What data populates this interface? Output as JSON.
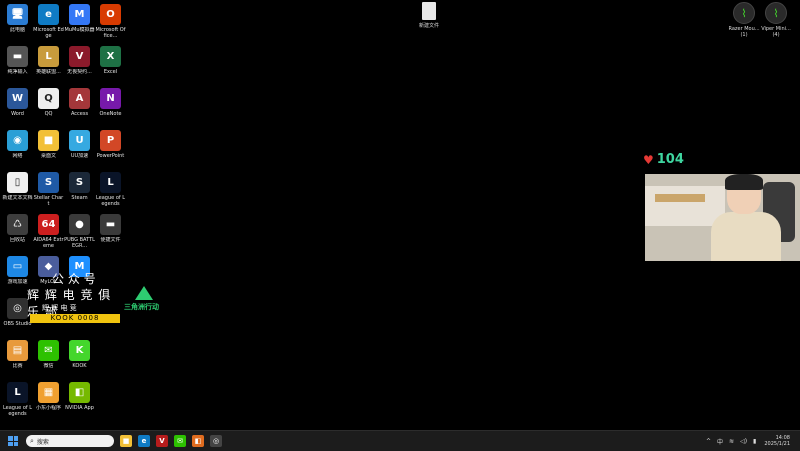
{
  "desktop_icons": [
    {
      "label": "此电脑",
      "glyph": "🖥",
      "color": "#2b7cd3"
    },
    {
      "label": "Microsoft Edge",
      "glyph": "e",
      "color": "#0f7bc4"
    },
    {
      "label": "MuMu模拟器",
      "glyph": "M",
      "color": "#3478f6"
    },
    {
      "label": "Microsoft Office...",
      "glyph": "O",
      "color": "#d83b01"
    },
    {
      "label": "纯净输入",
      "glyph": "▬",
      "color": "#555555"
    },
    {
      "label": "英雄联盟...",
      "glyph": "L",
      "color": "#c89b3c"
    },
    {
      "label": "无畏契约...",
      "glyph": "V",
      "color": "#8b1a2b"
    },
    {
      "label": "Excel",
      "glyph": "X",
      "color": "#1e7145"
    },
    {
      "label": "Word",
      "glyph": "W",
      "color": "#2b579a"
    },
    {
      "label": "QQ",
      "glyph": "Q",
      "color": "#eeeeee"
    },
    {
      "label": "Access",
      "glyph": "A",
      "color": "#a4373a"
    },
    {
      "label": "OneNote",
      "glyph": "N",
      "color": "#7719aa"
    },
    {
      "label": "网络",
      "glyph": "◉",
      "color": "#2a9fd6"
    },
    {
      "label": "桌面文",
      "glyph": "■",
      "color": "#f2c037"
    },
    {
      "label": "UU加速",
      "glyph": "U",
      "color": "#36a9e1"
    },
    {
      "label": "PowerPoint",
      "glyph": "P",
      "color": "#d24726"
    },
    {
      "label": "新建文本文档",
      "glyph": "▯",
      "color": "#f0f0f0"
    },
    {
      "label": "Stellar Chart",
      "glyph": "S",
      "color": "#1f5aa6"
    },
    {
      "label": "Steam",
      "glyph": "S",
      "color": "#1b2838"
    },
    {
      "label": "League of Legends",
      "glyph": "L",
      "color": "#0a1428"
    },
    {
      "label": "回收站",
      "glyph": "♺",
      "color": "#3d3d3d"
    },
    {
      "label": "AIDA64 Extreme",
      "glyph": "64",
      "color": "#cc1f1f"
    },
    {
      "label": "PUBG BATTLEGR...",
      "glyph": "●",
      "color": "#3a3a3a"
    },
    {
      "label": "便捷文件",
      "glyph": "▬",
      "color": "#3a3a3a"
    },
    {
      "label": "游戏加速",
      "glyph": "▭",
      "color": "#1e88e5"
    },
    {
      "label": "MyLOL",
      "glyph": "◆",
      "color": "#4a5d9c"
    },
    {
      "label": "",
      "glyph": "M",
      "color": "#1e90ff"
    },
    {
      "label": "",
      "glyph": "",
      "color": "#000000"
    },
    {
      "label": "OBS Studio",
      "glyph": "◎",
      "color": "#303030"
    },
    {
      "label": "",
      "glyph": "",
      "color": "#000000"
    },
    {
      "label": "",
      "glyph": "",
      "color": "#000000"
    },
    {
      "label": "",
      "glyph": "",
      "color": "#000000"
    },
    {
      "label": "比赛",
      "glyph": "▤",
      "color": "#e89a3c"
    },
    {
      "label": "微信",
      "glyph": "✉",
      "color": "#2dc100"
    },
    {
      "label": "KOOK",
      "glyph": "K",
      "color": "#44d62c"
    },
    {
      "label": "",
      "glyph": "",
      "color": "#000000"
    },
    {
      "label": "League of Legends",
      "glyph": "L",
      "color": "#0a1428"
    },
    {
      "label": "小东小程序",
      "glyph": "▦",
      "color": "#f0a030"
    },
    {
      "label": "NVIDIA App",
      "glyph": "◧",
      "color": "#76b900"
    },
    {
      "label": "",
      "glyph": "",
      "color": "#000000"
    }
  ],
  "center_file": {
    "label": "新建文件"
  },
  "razer_icons": [
    {
      "label": "Razer Mou... (1)"
    },
    {
      "label": "Viper Mini... (4)"
    }
  ],
  "club_overlay": {
    "gongzhonghao": "公 众 号",
    "name": "辉 辉 电 竞 俱 乐 部",
    "sub": "辉  辉  电  竞",
    "kook": "KOOK 0008"
  },
  "triangle_overlay": {
    "label": "三角洲行动"
  },
  "stream_overlay": {
    "heart": "♥",
    "count": "104"
  },
  "taskbar": {
    "search_placeholder": "搜索",
    "apps": [
      {
        "name": "file-explorer-app",
        "glyph": "■",
        "color": "#f2c037"
      },
      {
        "name": "edge-app",
        "glyph": "e",
        "color": "#0f7bc4"
      },
      {
        "name": "valorant-app",
        "glyph": "V",
        "color": "#b71c1c"
      },
      {
        "name": "wechat-app",
        "glyph": "✉",
        "color": "#2dc100"
      },
      {
        "name": "store-app",
        "glyph": "◧",
        "color": "#e06c1f"
      },
      {
        "name": "obs-app",
        "glyph": "◎",
        "color": "#444444"
      }
    ],
    "tray": {
      "chevron": "^",
      "lang": "中",
      "wifi": "≋",
      "volume": "◁)",
      "battery": "▮"
    },
    "time": "14:08",
    "date": "2025/1/21"
  }
}
